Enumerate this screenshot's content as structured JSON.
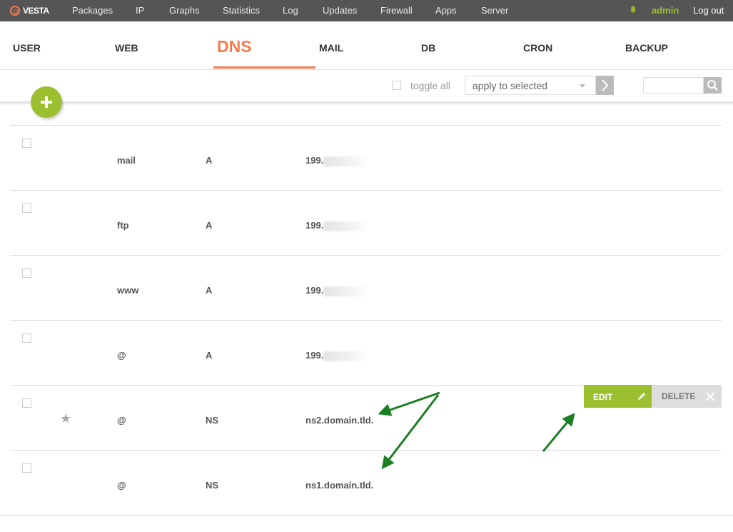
{
  "topbar": {
    "logo_text": "VESTA",
    "nav": [
      "Packages",
      "IP",
      "Graphs",
      "Statistics",
      "Log",
      "Updates",
      "Firewall",
      "Apps",
      "Server"
    ],
    "user": "admin",
    "logout": "Log out"
  },
  "tabs": [
    "USER",
    "WEB",
    "DNS",
    "MAIL",
    "DB",
    "CRON",
    "BACKUP"
  ],
  "active_tab": "DNS",
  "toolbar": {
    "toggle_all": "toggle all",
    "apply_placeholder": "apply to selected",
    "search_value": ""
  },
  "records": [
    {
      "name": "mail",
      "type": "A",
      "value": "199."
    },
    {
      "name": "ftp",
      "type": "A",
      "value": "199."
    },
    {
      "name": "www",
      "type": "A",
      "value": "199."
    },
    {
      "name": "@",
      "type": "A",
      "value": "199."
    },
    {
      "name": "@",
      "type": "NS",
      "value": "ns2.domain.tld."
    },
    {
      "name": "@",
      "type": "NS",
      "value": "ns1.domain.tld."
    }
  ],
  "row_actions": {
    "edit": "EDIT",
    "delete": "DELETE"
  },
  "colors": {
    "accent": "#f37b4f",
    "green": "#9bbf2f",
    "arrow": "#1a7f23",
    "topbar": "#555555"
  }
}
